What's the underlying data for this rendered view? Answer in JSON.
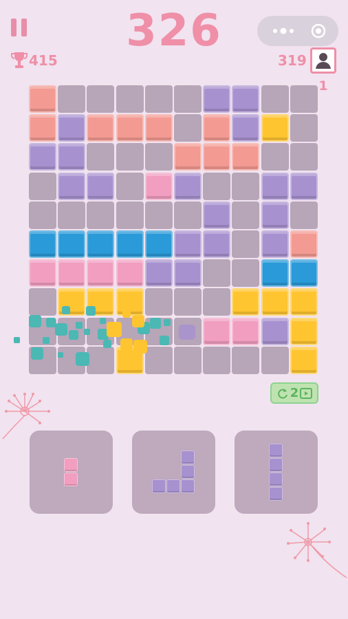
{
  "score": "326",
  "best_score": "415",
  "opponent": {
    "score": "319",
    "rank": "1"
  },
  "refresh": {
    "count": "2"
  },
  "colors": {
    "salmon": "#f39a92",
    "purple": "#a891cf",
    "yellow": "#ffc531",
    "pink": "#f19ec0",
    "blue": "#2a9ad8",
    "empty": "#b7a5b8",
    "accent": "#ef8fa8"
  },
  "board": [
    [
      "salmon",
      "",
      "",
      "",
      "",
      "",
      "purple",
      "purple",
      "",
      ""
    ],
    [
      "salmon",
      "purple",
      "salmon",
      "salmon",
      "salmon",
      "",
      "salmon",
      "purple",
      "yellow",
      ""
    ],
    [
      "purple",
      "purple",
      "",
      "",
      "",
      "salmon",
      "salmon",
      "salmon",
      "",
      ""
    ],
    [
      "",
      "purple",
      "purple",
      "",
      "pink",
      "purple",
      "",
      "",
      "purple",
      "purple"
    ],
    [
      "",
      "",
      "",
      "",
      "",
      "",
      "purple",
      "",
      "purple",
      ""
    ],
    [
      "blue",
      "blue",
      "blue",
      "blue",
      "blue",
      "purple",
      "purple",
      "",
      "purple",
      "salmon"
    ],
    [
      "pink",
      "pink",
      "pink",
      "pink",
      "purple",
      "purple",
      "",
      "",
      "blue",
      "blue"
    ],
    [
      "",
      "yellow",
      "yellow",
      "yellow",
      "",
      "",
      "",
      "yellow",
      "yellow",
      "yellow"
    ],
    [
      "",
      "",
      "",
      "",
      "",
      "",
      "pink",
      "pink",
      "purple",
      "yellow"
    ],
    [
      "",
      "",
      "",
      "yellow",
      "",
      "",
      "",
      "",
      "",
      "yellow"
    ]
  ],
  "pieces": [
    {
      "color": "pink",
      "cells": [
        [
          0,
          0
        ],
        [
          0,
          1
        ]
      ]
    },
    {
      "color": "purple",
      "cells": [
        [
          2,
          0
        ],
        [
          2,
          1
        ],
        [
          0,
          2
        ],
        [
          1,
          2
        ],
        [
          2,
          2
        ]
      ]
    },
    {
      "color": "purple",
      "cells": [
        [
          0,
          0
        ],
        [
          0,
          1
        ],
        [
          0,
          2
        ],
        [
          0,
          3
        ]
      ]
    }
  ],
  "icons": {
    "pause": "pause-icon",
    "menu": "more-dots-icon",
    "close": "target-circle-icon",
    "trophy": "trophy-icon",
    "user": "user-icon",
    "refresh": "refresh-icon",
    "video": "video-ad-icon"
  }
}
